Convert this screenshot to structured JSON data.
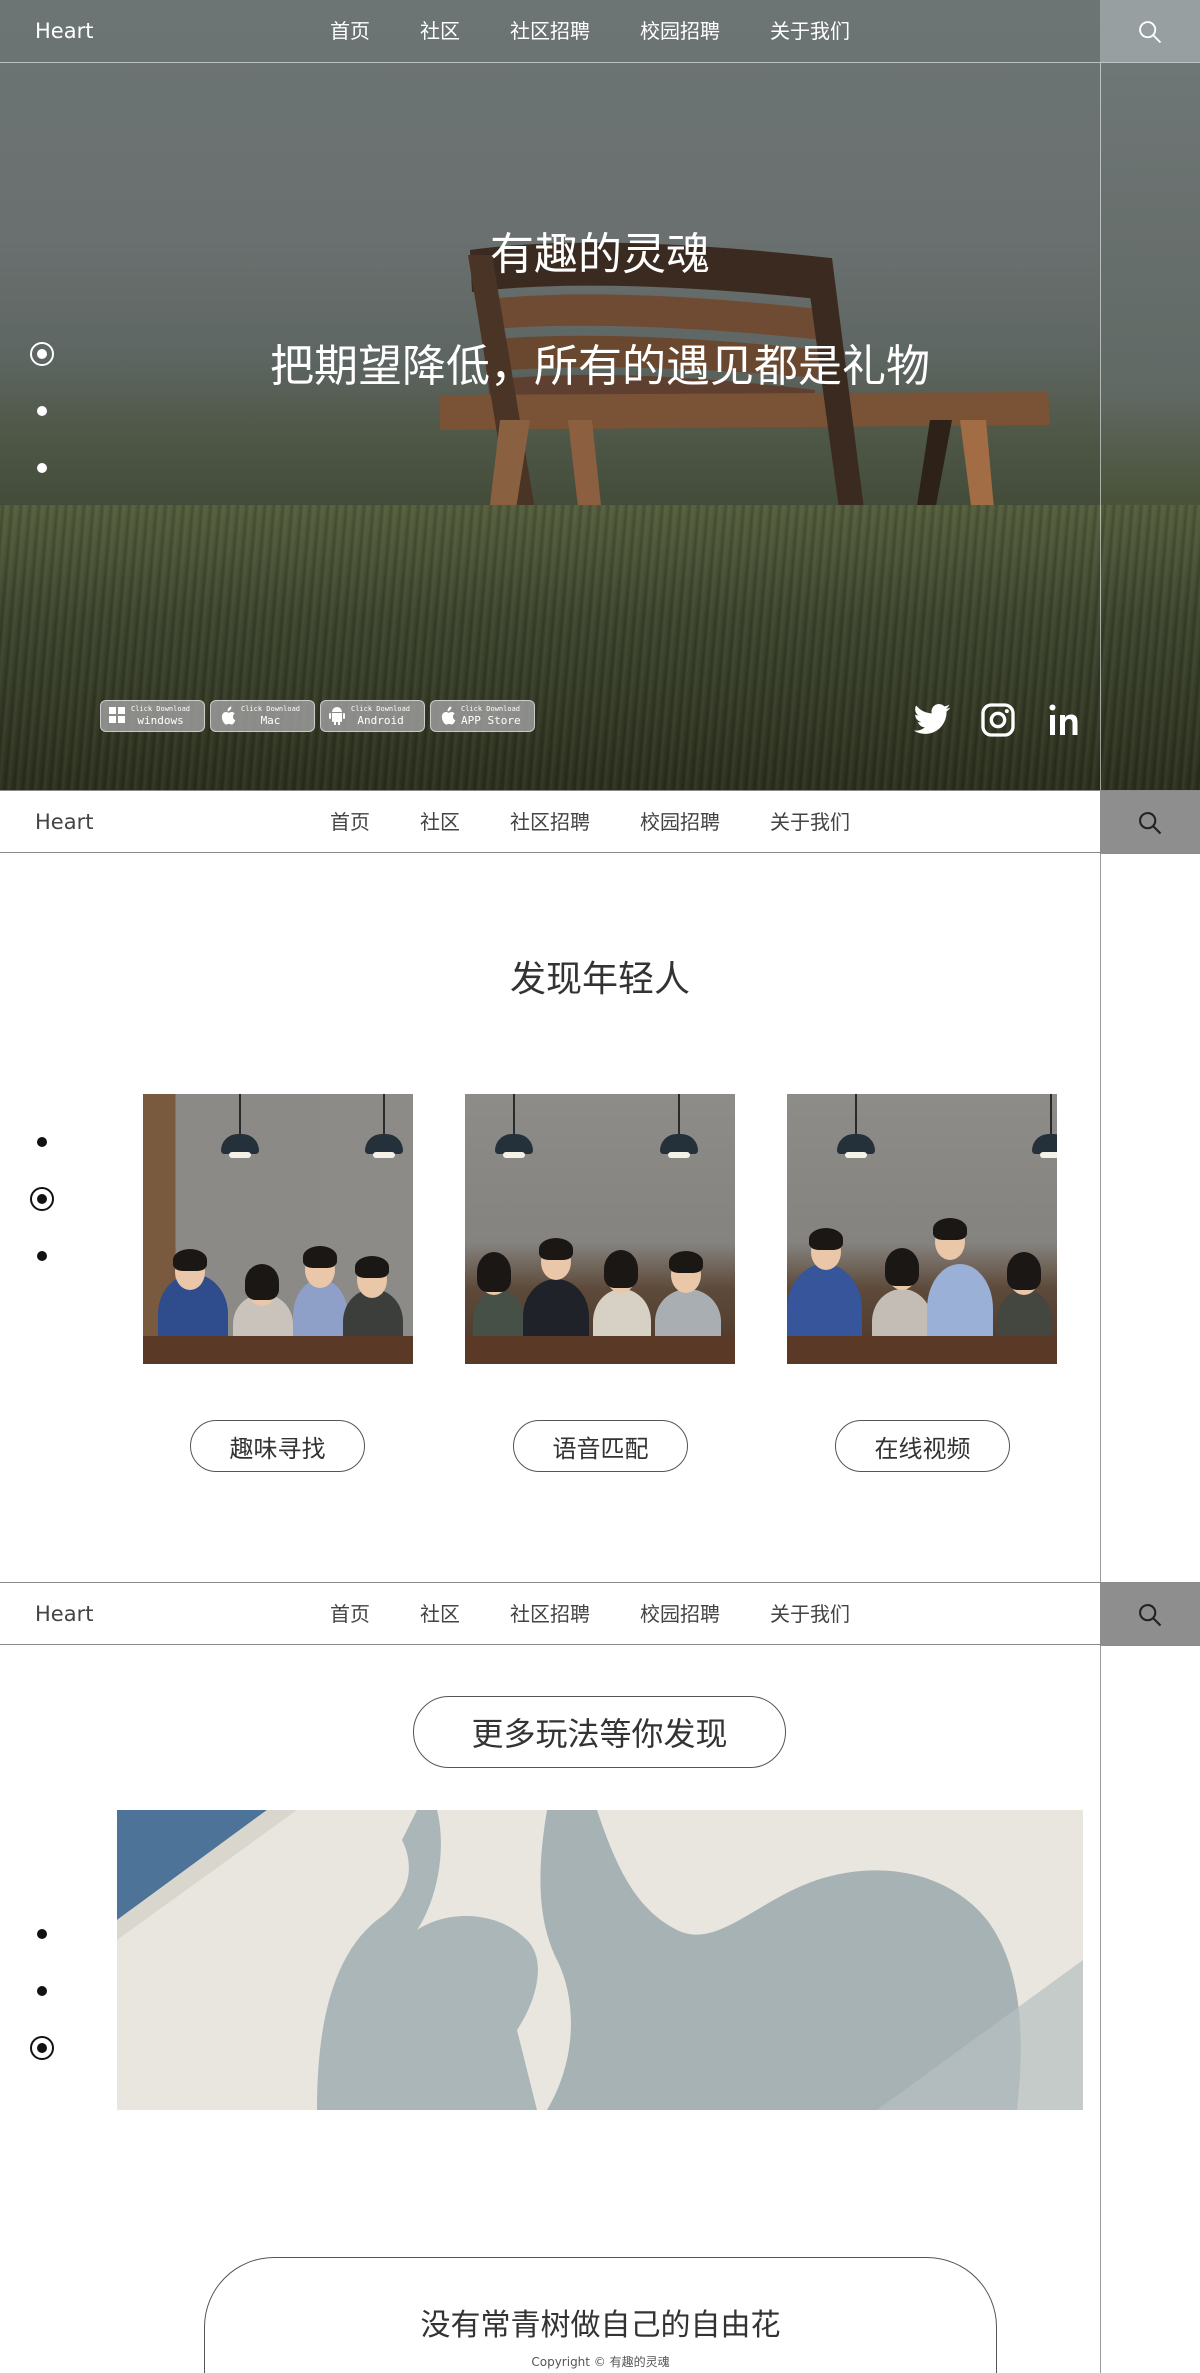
{
  "header": {
    "logo": "Heart",
    "nav": [
      "首页",
      "社区",
      "社区招聘",
      "校园招聘",
      "关于我们"
    ]
  },
  "hero": {
    "title": "有趣的灵魂",
    "subtitle": "把期望降低，所有的遇见都是礼物",
    "active_slide_index": 0,
    "downloads": [
      {
        "small": "Click Download",
        "name": "windows",
        "icon": "windows-icon"
      },
      {
        "small": "Click Download",
        "name": "Mac",
        "icon": "apple-icon"
      },
      {
        "small": "Click Download",
        "name": "Android",
        "icon": "android-icon"
      },
      {
        "small": "Click Download",
        "name": "APP Store",
        "icon": "apple-icon"
      }
    ],
    "social": [
      "twitter-icon",
      "instagram-icon",
      "linkedin-icon"
    ]
  },
  "discover": {
    "title": "发现年轻人",
    "active_slide_index": 1,
    "features": [
      "趣味寻找",
      "语音匹配",
      "在线视频"
    ]
  },
  "more": {
    "title": "更多玩法等你发现",
    "active_slide_index": 2
  },
  "footer": {
    "slogan": "没有常青树做自己的自由花",
    "copyright": "Copyright © 有趣的灵魂"
  },
  "colors": {
    "hero_text": "#ffffff",
    "light_header_search_bg": "#8e8e8e",
    "rule": "#9a9a9a"
  }
}
